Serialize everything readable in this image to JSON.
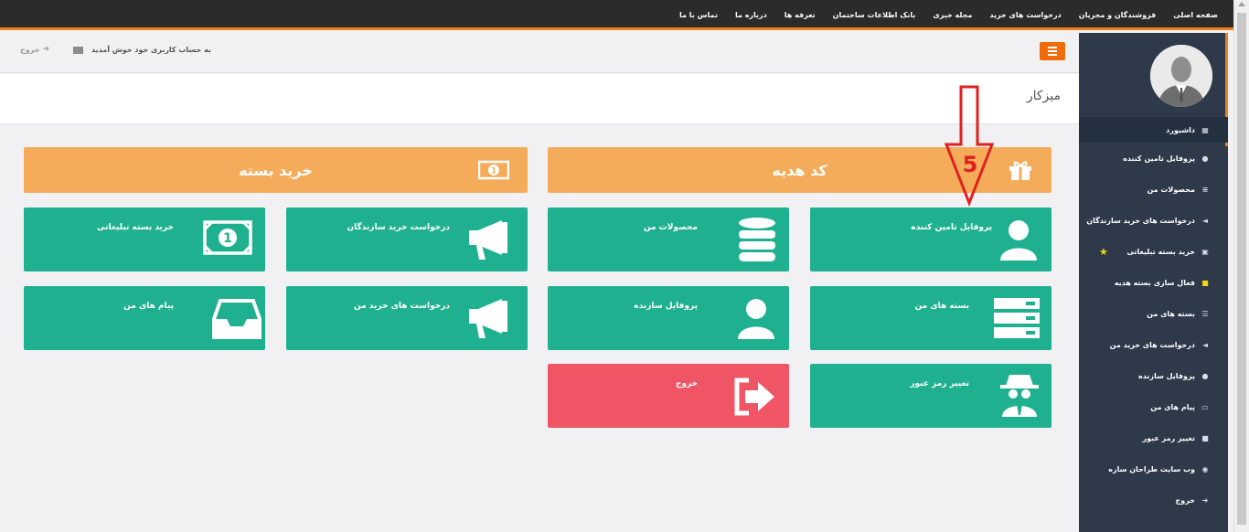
{
  "topnav": {
    "items": [
      "صفحه اصلی",
      "فروشندگان و مجریان",
      "درخواست های خرید",
      "مجله خبری",
      "بانک اطلاعات ساختمان",
      "تعرفه ها",
      "درباره ما",
      "تماس با ما"
    ]
  },
  "toolbar": {
    "welcome": "به حساب کاربری خود خوش آمدید",
    "logout": "خروج"
  },
  "page": {
    "title": "میزکار"
  },
  "banners": {
    "gift": "کد هدیه",
    "buy": "خرید بسته"
  },
  "tiles": {
    "supplier_profile": "پروفایل تامین کننده",
    "my_products": "محصولات من",
    "builder_requests": "درخواست خرید سازندگان",
    "buy_ad_package": "خرید بسته تبلیغاتی",
    "my_packages": "بسته های من",
    "builder_profile": "پروفایل سازنده",
    "my_requests": "درخواست های خرید من",
    "my_messages": "پیام های من",
    "change_password": "تغییر رمز عبور",
    "exit": "خروج"
  },
  "annotation": {
    "number": "5"
  },
  "sidebar": {
    "items": [
      {
        "label": "داشبورد",
        "icon": "dashboard-icon"
      },
      {
        "label": "پروفایل تامین کننده",
        "icon": "user-icon"
      },
      {
        "label": "محصولات من",
        "icon": "database-icon"
      },
      {
        "label": "درخواست های خرید سازندگان",
        "icon": "bullhorn-icon"
      },
      {
        "label": "خرید بسته تبلیغاتی",
        "icon": "money-icon"
      },
      {
        "label": "فعال سازی بسته هدیه",
        "icon": "gift-icon"
      },
      {
        "label": "بسته های من",
        "icon": "list-icon"
      },
      {
        "label": "درخواست های خرید من",
        "icon": "bullhorn-icon"
      },
      {
        "label": "پروفایل سازنده",
        "icon": "user-icon"
      },
      {
        "label": "پیام های من",
        "icon": "inbox-icon"
      },
      {
        "label": "تغییر رمز عبور",
        "icon": "lock-icon"
      },
      {
        "label": "وب سایت طراحان سازه",
        "icon": "eye-icon"
      },
      {
        "label": "خروج",
        "icon": "sign-out-icon"
      }
    ]
  },
  "colors": {
    "accent": "#f0801e",
    "tile": "#1fb18f",
    "danger": "#ef5565",
    "banner": "#f5ac5a",
    "sidebar": "#2e3a4a"
  }
}
